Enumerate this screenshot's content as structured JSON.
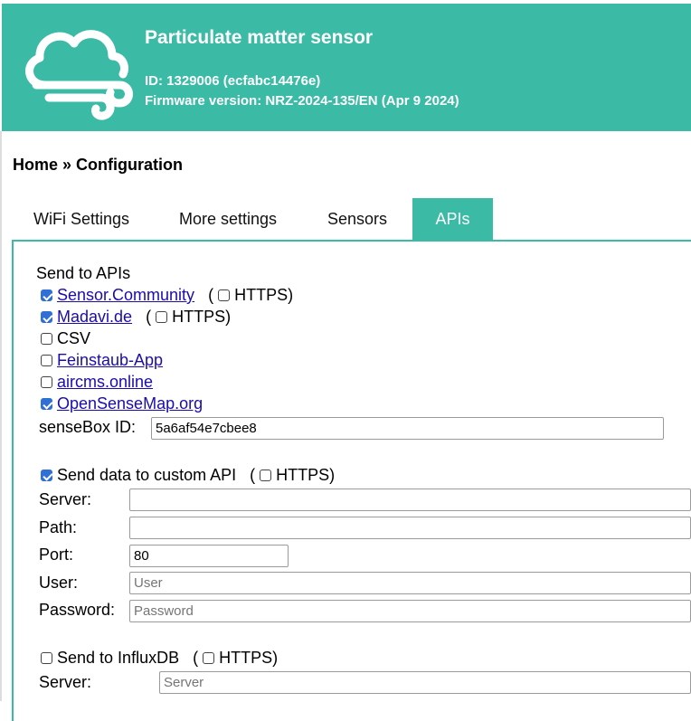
{
  "header": {
    "title": "Particulate matter sensor",
    "id_line": "ID: 1329006 (ecfabc14476e)",
    "firmware_line": "Firmware version: NRZ-2024-135/EN (Apr 9 2024)",
    "accent_color": "#3bbaa6",
    "logo_icon": "cloud-wind-icon"
  },
  "breadcrumb": "Home » Configuration",
  "tabs": [
    {
      "label": "WiFi Settings",
      "active": false
    },
    {
      "label": "More settings",
      "active": false
    },
    {
      "label": "Sensors",
      "active": false
    },
    {
      "label": "APIs",
      "active": true
    }
  ],
  "apis": {
    "heading": "Send to APIs",
    "https_label": "HTTPS",
    "paren_open": "(",
    "paren_close": ")",
    "items": [
      {
        "label": "Sensor.Community",
        "checked": true,
        "https": false
      },
      {
        "label": "Madavi.de",
        "checked": true,
        "https": false
      },
      {
        "label": "CSV",
        "checked": false
      },
      {
        "label": "Feinstaub-App",
        "checked": false
      },
      {
        "label": "aircms.online",
        "checked": false
      },
      {
        "label": "OpenSenseMap.org",
        "checked": true
      }
    ],
    "sensebox_label": "senseBox ID:",
    "sensebox_value": "5a6af54e7cbee8"
  },
  "custom_api": {
    "label": "Send data to custom API",
    "checked": true,
    "https": false,
    "server_label": "Server:",
    "server_value": "",
    "path_label": "Path:",
    "path_value": "",
    "port_label": "Port:",
    "port_value": "80",
    "user_label": "User:",
    "user_placeholder": "User",
    "password_label": "Password:",
    "password_placeholder": "Password"
  },
  "influx": {
    "label": "Send to InfluxDB",
    "checked": false,
    "https": false,
    "server_label": "Server:",
    "server_placeholder": "Server"
  }
}
